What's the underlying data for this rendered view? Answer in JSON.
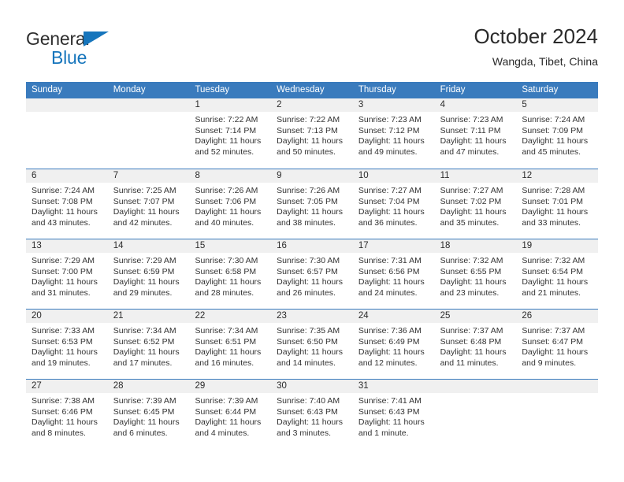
{
  "brand": {
    "name_part1": "General",
    "name_part2": "Blue",
    "colors": {
      "blue": "#1675bc",
      "dark": "#2e2e2e"
    }
  },
  "header": {
    "title": "October 2024",
    "subtitle": "Wangda, Tibet, China"
  },
  "theme": {
    "header_blue": "#3a7bbd",
    "day_number_band": "#f0f0f0",
    "text": "#2b2b2b"
  },
  "weekdays": [
    "Sunday",
    "Monday",
    "Tuesday",
    "Wednesday",
    "Thursday",
    "Friday",
    "Saturday"
  ],
  "weeks": [
    [
      {
        "day": "",
        "empty": true
      },
      {
        "day": "",
        "empty": true
      },
      {
        "day": "1",
        "sunrise": "Sunrise: 7:22 AM",
        "sunset": "Sunset: 7:14 PM",
        "daylight_line1": "Daylight: 11 hours",
        "daylight_line2": "and 52 minutes."
      },
      {
        "day": "2",
        "sunrise": "Sunrise: 7:22 AM",
        "sunset": "Sunset: 7:13 PM",
        "daylight_line1": "Daylight: 11 hours",
        "daylight_line2": "and 50 minutes."
      },
      {
        "day": "3",
        "sunrise": "Sunrise: 7:23 AM",
        "sunset": "Sunset: 7:12 PM",
        "daylight_line1": "Daylight: 11 hours",
        "daylight_line2": "and 49 minutes."
      },
      {
        "day": "4",
        "sunrise": "Sunrise: 7:23 AM",
        "sunset": "Sunset: 7:11 PM",
        "daylight_line1": "Daylight: 11 hours",
        "daylight_line2": "and 47 minutes."
      },
      {
        "day": "5",
        "sunrise": "Sunrise: 7:24 AM",
        "sunset": "Sunset: 7:09 PM",
        "daylight_line1": "Daylight: 11 hours",
        "daylight_line2": "and 45 minutes."
      }
    ],
    [
      {
        "day": "6",
        "sunrise": "Sunrise: 7:24 AM",
        "sunset": "Sunset: 7:08 PM",
        "daylight_line1": "Daylight: 11 hours",
        "daylight_line2": "and 43 minutes."
      },
      {
        "day": "7",
        "sunrise": "Sunrise: 7:25 AM",
        "sunset": "Sunset: 7:07 PM",
        "daylight_line1": "Daylight: 11 hours",
        "daylight_line2": "and 42 minutes."
      },
      {
        "day": "8",
        "sunrise": "Sunrise: 7:26 AM",
        "sunset": "Sunset: 7:06 PM",
        "daylight_line1": "Daylight: 11 hours",
        "daylight_line2": "and 40 minutes."
      },
      {
        "day": "9",
        "sunrise": "Sunrise: 7:26 AM",
        "sunset": "Sunset: 7:05 PM",
        "daylight_line1": "Daylight: 11 hours",
        "daylight_line2": "and 38 minutes."
      },
      {
        "day": "10",
        "sunrise": "Sunrise: 7:27 AM",
        "sunset": "Sunset: 7:04 PM",
        "daylight_line1": "Daylight: 11 hours",
        "daylight_line2": "and 36 minutes."
      },
      {
        "day": "11",
        "sunrise": "Sunrise: 7:27 AM",
        "sunset": "Sunset: 7:02 PM",
        "daylight_line1": "Daylight: 11 hours",
        "daylight_line2": "and 35 minutes."
      },
      {
        "day": "12",
        "sunrise": "Sunrise: 7:28 AM",
        "sunset": "Sunset: 7:01 PM",
        "daylight_line1": "Daylight: 11 hours",
        "daylight_line2": "and 33 minutes."
      }
    ],
    [
      {
        "day": "13",
        "sunrise": "Sunrise: 7:29 AM",
        "sunset": "Sunset: 7:00 PM",
        "daylight_line1": "Daylight: 11 hours",
        "daylight_line2": "and 31 minutes."
      },
      {
        "day": "14",
        "sunrise": "Sunrise: 7:29 AM",
        "sunset": "Sunset: 6:59 PM",
        "daylight_line1": "Daylight: 11 hours",
        "daylight_line2": "and 29 minutes."
      },
      {
        "day": "15",
        "sunrise": "Sunrise: 7:30 AM",
        "sunset": "Sunset: 6:58 PM",
        "daylight_line1": "Daylight: 11 hours",
        "daylight_line2": "and 28 minutes."
      },
      {
        "day": "16",
        "sunrise": "Sunrise: 7:30 AM",
        "sunset": "Sunset: 6:57 PM",
        "daylight_line1": "Daylight: 11 hours",
        "daylight_line2": "and 26 minutes."
      },
      {
        "day": "17",
        "sunrise": "Sunrise: 7:31 AM",
        "sunset": "Sunset: 6:56 PM",
        "daylight_line1": "Daylight: 11 hours",
        "daylight_line2": "and 24 minutes."
      },
      {
        "day": "18",
        "sunrise": "Sunrise: 7:32 AM",
        "sunset": "Sunset: 6:55 PM",
        "daylight_line1": "Daylight: 11 hours",
        "daylight_line2": "and 23 minutes."
      },
      {
        "day": "19",
        "sunrise": "Sunrise: 7:32 AM",
        "sunset": "Sunset: 6:54 PM",
        "daylight_line1": "Daylight: 11 hours",
        "daylight_line2": "and 21 minutes."
      }
    ],
    [
      {
        "day": "20",
        "sunrise": "Sunrise: 7:33 AM",
        "sunset": "Sunset: 6:53 PM",
        "daylight_line1": "Daylight: 11 hours",
        "daylight_line2": "and 19 minutes."
      },
      {
        "day": "21",
        "sunrise": "Sunrise: 7:34 AM",
        "sunset": "Sunset: 6:52 PM",
        "daylight_line1": "Daylight: 11 hours",
        "daylight_line2": "and 17 minutes."
      },
      {
        "day": "22",
        "sunrise": "Sunrise: 7:34 AM",
        "sunset": "Sunset: 6:51 PM",
        "daylight_line1": "Daylight: 11 hours",
        "daylight_line2": "and 16 minutes."
      },
      {
        "day": "23",
        "sunrise": "Sunrise: 7:35 AM",
        "sunset": "Sunset: 6:50 PM",
        "daylight_line1": "Daylight: 11 hours",
        "daylight_line2": "and 14 minutes."
      },
      {
        "day": "24",
        "sunrise": "Sunrise: 7:36 AM",
        "sunset": "Sunset: 6:49 PM",
        "daylight_line1": "Daylight: 11 hours",
        "daylight_line2": "and 12 minutes."
      },
      {
        "day": "25",
        "sunrise": "Sunrise: 7:37 AM",
        "sunset": "Sunset: 6:48 PM",
        "daylight_line1": "Daylight: 11 hours",
        "daylight_line2": "and 11 minutes."
      },
      {
        "day": "26",
        "sunrise": "Sunrise: 7:37 AM",
        "sunset": "Sunset: 6:47 PM",
        "daylight_line1": "Daylight: 11 hours",
        "daylight_line2": "and 9 minutes."
      }
    ],
    [
      {
        "day": "27",
        "sunrise": "Sunrise: 7:38 AM",
        "sunset": "Sunset: 6:46 PM",
        "daylight_line1": "Daylight: 11 hours",
        "daylight_line2": "and 8 minutes."
      },
      {
        "day": "28",
        "sunrise": "Sunrise: 7:39 AM",
        "sunset": "Sunset: 6:45 PM",
        "daylight_line1": "Daylight: 11 hours",
        "daylight_line2": "and 6 minutes."
      },
      {
        "day": "29",
        "sunrise": "Sunrise: 7:39 AM",
        "sunset": "Sunset: 6:44 PM",
        "daylight_line1": "Daylight: 11 hours",
        "daylight_line2": "and 4 minutes."
      },
      {
        "day": "30",
        "sunrise": "Sunrise: 7:40 AM",
        "sunset": "Sunset: 6:43 PM",
        "daylight_line1": "Daylight: 11 hours",
        "daylight_line2": "and 3 minutes."
      },
      {
        "day": "31",
        "sunrise": "Sunrise: 7:41 AM",
        "sunset": "Sunset: 6:43 PM",
        "daylight_line1": "Daylight: 11 hours",
        "daylight_line2": "and 1 minute."
      },
      {
        "day": "",
        "empty": true
      },
      {
        "day": "",
        "empty": true
      }
    ]
  ]
}
